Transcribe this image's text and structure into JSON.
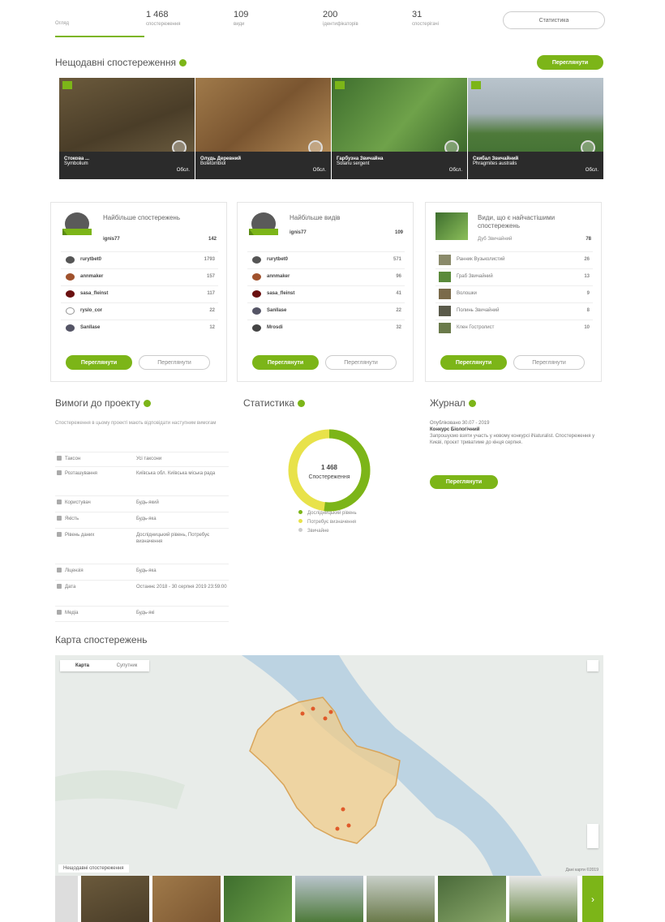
{
  "tabs": [
    {
      "num": "",
      "label": "Огляд"
    },
    {
      "num": "1 468",
      "label": "спостереження"
    },
    {
      "num": "109",
      "label": "види"
    },
    {
      "num": "200",
      "label": "ідентифікаторів"
    },
    {
      "num": "31",
      "label": "спостерігачі"
    }
  ],
  "stats_button": "Статистика",
  "section_recent": "Нещодавні спостереження",
  "view_all": "Переглянути",
  "photos": [
    {
      "name": "Стокова ...",
      "latin": "Symbolium",
      "count": "Обсл."
    },
    {
      "name": "Олудь Деревний",
      "latin": "Boletombiol",
      "count": "Обсл."
    },
    {
      "name": "Гарбузна Звичайна",
      "latin": "Solanu sergent",
      "count": "Обсл."
    },
    {
      "name": "Скибал Звичайний",
      "latin": "Phragmites australis",
      "count": "Обсл."
    }
  ],
  "card_observers": {
    "title": "Найбільше спостережень",
    "leader": {
      "name": "ignis77",
      "value": "142"
    },
    "rows": [
      {
        "name": "rurytbet0",
        "value": "1793"
      },
      {
        "name": "annmaker",
        "value": "157"
      },
      {
        "name": "sasa_fleinst",
        "value": "117"
      },
      {
        "name": "ryslo_cor",
        "value": "22"
      },
      {
        "name": "Sanllase",
        "value": "12"
      }
    ],
    "btn_primary": "Переглянути",
    "btn_secondary": "Переглянути"
  },
  "card_species": {
    "title": "Найбільше видів",
    "leader": {
      "name": "ignis77",
      "value": "109"
    },
    "rows": [
      {
        "name": "rurytbet0",
        "value": "571"
      },
      {
        "name": "annmaker",
        "value": "96"
      },
      {
        "name": "sasa_fleinst",
        "value": "41"
      },
      {
        "name": "Sanllase",
        "value": "22"
      },
      {
        "name": "Mrosdi",
        "value": "32"
      }
    ],
    "btn_primary": "Переглянути",
    "btn_secondary": "Переглянути"
  },
  "card_top_species": {
    "title": "Види, що є найчастішими спостережень",
    "leader": {
      "name": "Дуб Звичайний",
      "value": "78"
    },
    "rows": [
      {
        "name": "Ранник Вузьколистий",
        "value": "26"
      },
      {
        "name": "Граб Звичайний",
        "value": "13"
      },
      {
        "name": "Волошки",
        "value": "9"
      },
      {
        "name": "Полинь Звичайний",
        "value": "8"
      },
      {
        "name": "Клен Гостролист",
        "value": "10"
      }
    ],
    "btn_primary": "Переглянути",
    "btn_secondary": "Переглянути"
  },
  "section_requirements": "Вимоги до проекту",
  "requirements_intro": "Спостереження в цьому проекті мають відповідати наступним вимогам",
  "requirements": [
    {
      "key": "Таксон",
      "value": "Усі таксони"
    },
    {
      "key": "Розташування",
      "value": "Київська обл. Київська міська рада"
    },
    {
      "key": "Користувач",
      "value": "Будь-який"
    },
    {
      "key": "Якість",
      "value": "Будь-яка"
    },
    {
      "key": "Рівень даних",
      "value": "Дослідницький рівень, Потребує визначення"
    },
    {
      "key": "Ліцензія",
      "value": "Будь-яка"
    },
    {
      "key": "Дата",
      "value": "Останнє 2018 - 30 серпня 2019 23:59:00"
    },
    {
      "key": "Медіа",
      "value": "Будь-які"
    }
  ],
  "section_stats": "Статистика",
  "donut": {
    "value": "1 468",
    "label": "Спостереження"
  },
  "stats_legend": [
    {
      "label": "Дослідницький рівень",
      "color": "#7cb518"
    },
    {
      "label": "Потребує визначення",
      "color": "#e8e24a"
    },
    {
      "label": "Звичайне",
      "color": "#cccccc"
    }
  ],
  "stats_chart": {
    "research": 0.52,
    "needs_id": 0.46,
    "casual": 0.02
  },
  "section_journal": "Журнал",
  "journal": {
    "date": "Опубліковано 30.07 - 2019",
    "title": "Конкурс Біологічний",
    "text": "Запрошуємо взяти участь у новому конкурсі iNaturalist. Спостереження у Києві, проєкт триватиме до кінця серпня.",
    "button": "Переглянути"
  },
  "section_map": "Карта спостережень",
  "map_tabs": [
    "Карта",
    "Супутник"
  ],
  "map_caption": "Нещодавні спостереження",
  "map_attrib": "Дані карти ©2019"
}
